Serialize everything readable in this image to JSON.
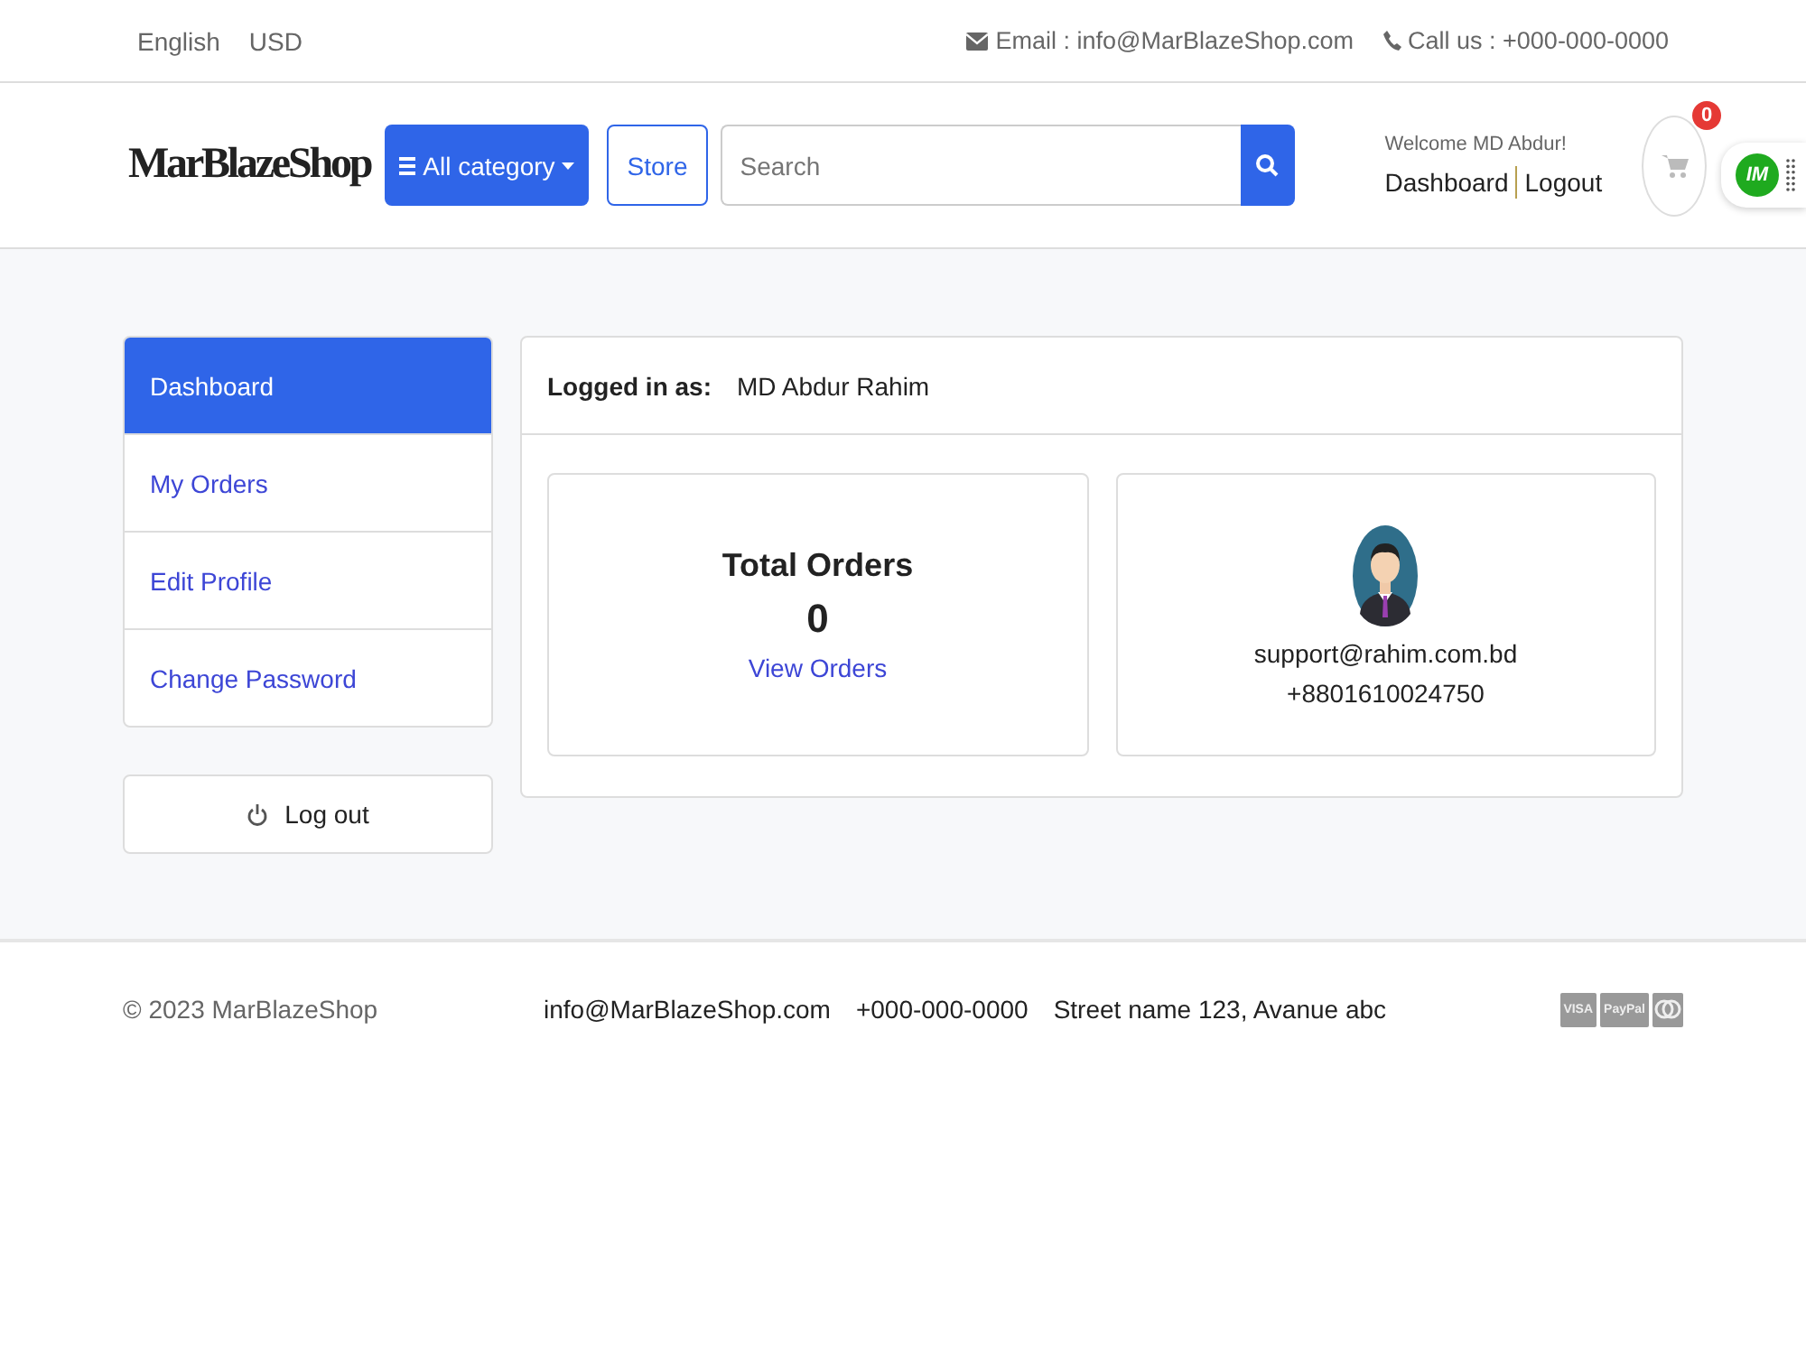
{
  "topbar": {
    "language": "English",
    "currency": "USD",
    "email": "Email : info@MarBlazeShop.com",
    "phone": "Call us : +000-000-0000"
  },
  "header": {
    "logo": "MarBlazeShop",
    "category_button": "All category",
    "store_button": "Store",
    "search": {
      "placeholder": "Search"
    },
    "welcome": "Welcome MD Abdur!",
    "dashboard_link": "Dashboard",
    "logout_link": "Logout",
    "cart_count": "0",
    "floating_badge": "IM"
  },
  "sidebar": {
    "items": [
      {
        "label": "Dashboard",
        "selected": true
      },
      {
        "label": "My Orders",
        "selected": false
      },
      {
        "label": "Edit Profile",
        "selected": false
      },
      {
        "label": "Change Password",
        "selected": false
      }
    ],
    "logout_button": "Log out"
  },
  "panel": {
    "logged_in_label": "Logged in as:",
    "user_name": "MD Abdur Rahim",
    "orders_card": {
      "title": "Total Orders",
      "count": "0",
      "link": "View Orders"
    },
    "contact_card": {
      "email": "support@rahim.com.bd",
      "phone": "+8801610024750"
    }
  },
  "footer": {
    "copyright": "© 2023 MarBlazeShop",
    "email": "info@MarBlazeShop.com",
    "phone": "+000-000-0000",
    "address": "Street name 123, Avanue abc",
    "payments": [
      "VISA",
      "PayPal"
    ]
  }
}
